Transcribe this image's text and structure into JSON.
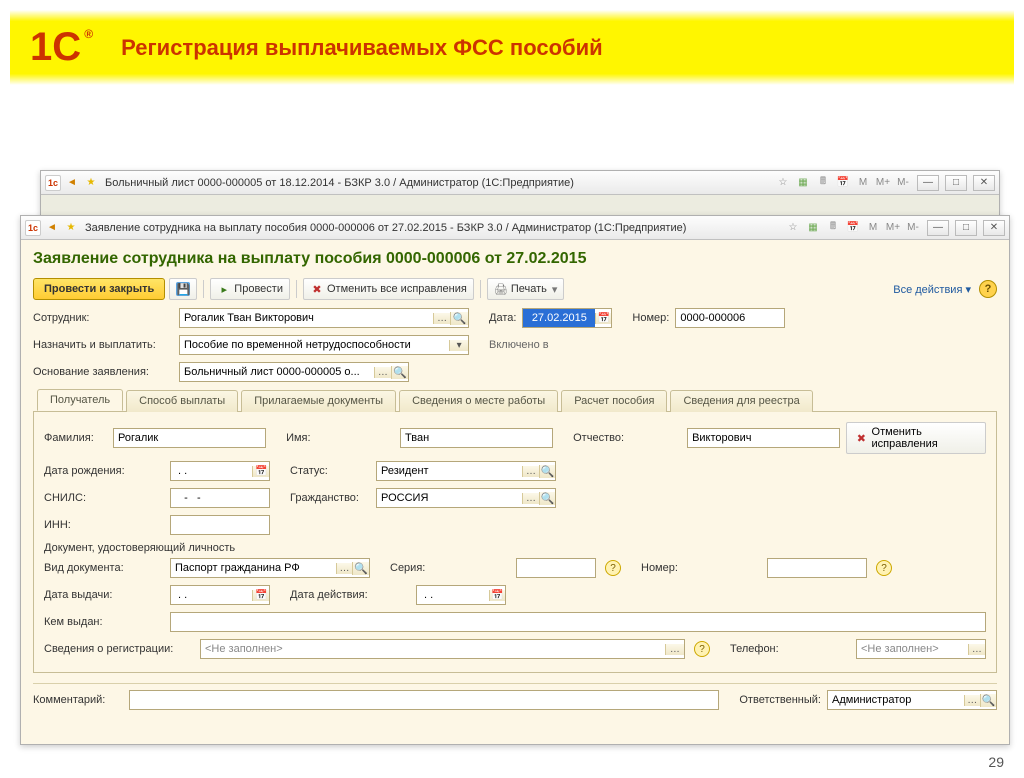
{
  "slide": {
    "title": "Регистрация выплачиваемых ФСС пособий",
    "page": "29"
  },
  "back_window": {
    "title": "Больничный лист 0000-000005 от 18.12.2014 - БЗКР 3.0 / Администратор  (1С:Предприятие)"
  },
  "front_window": {
    "title": "Заявление сотрудника на выплату пособия 0000-000006 от 27.02.2015 - БЗКР 3.0 / Администратор  (1С:Предприятие)",
    "doc_title": "Заявление сотрудника на выплату пособия 0000-000006 от 27.02.2015",
    "toolbar": {
      "submit_close": "Провести и закрыть",
      "submit": "Провести",
      "cancel_all": "Отменить все исправления",
      "print": "Печать",
      "all_actions": "Все действия"
    },
    "fields": {
      "employee_label": "Сотрудник:",
      "employee": "Рогалик Тван Викторович",
      "date_label": "Дата:",
      "date": "27.02.2015",
      "number_label": "Номер:",
      "number": "0000-000006",
      "assign_label": "Назначить и выплатить:",
      "assign": "Пособие по временной нетрудоспособности",
      "included_label": "Включено в",
      "basis_label": "Основание заявления:",
      "basis": "Больничный лист 0000-000005 о..."
    },
    "tabs": [
      "Получатель",
      "Способ выплаты",
      "Прилагаемые документы",
      "Сведения о месте работы",
      "Расчет пособия",
      "Сведения для реестра"
    ],
    "recipient": {
      "lastname_label": "Фамилия:",
      "lastname": "Рогалик",
      "firstname_label": "Имя:",
      "firstname": "Тван",
      "patronymic_label": "Отчество:",
      "patronymic": "Викторович",
      "cancel_corrections": "Отменить исправления",
      "dob_label": "Дата рождения:",
      "dob": " . .   ",
      "status_label": "Статус:",
      "status": "Резидент",
      "snils_label": "СНИЛС:",
      "snils": "   -   -",
      "citizenship_label": "Гражданство:",
      "citizenship": "РОССИЯ",
      "inn_label": "ИНН:",
      "inn": "",
      "id_section": "Документ, удостоверяющий личность",
      "doc_type_label": "Вид документа:",
      "doc_type": "Паспорт гражданина РФ",
      "series_label": "Серия:",
      "series": "",
      "number_label": "Номер:",
      "number": "",
      "issue_date_label": "Дата выдачи:",
      "issue_date": " . .   ",
      "valid_until_label": "Дата действия:",
      "valid_until": " . .",
      "issued_by_label": "Кем выдан:",
      "issued_by": "",
      "reg_info_label": "Сведения о регистрации:",
      "reg_info": "<Не заполнен>",
      "phone_label": "Телефон:",
      "phone": "<Не заполнен>",
      "comment_label": "Комментарий:",
      "comment": "",
      "responsible_label": "Ответственный:",
      "responsible": "Администратор"
    }
  }
}
